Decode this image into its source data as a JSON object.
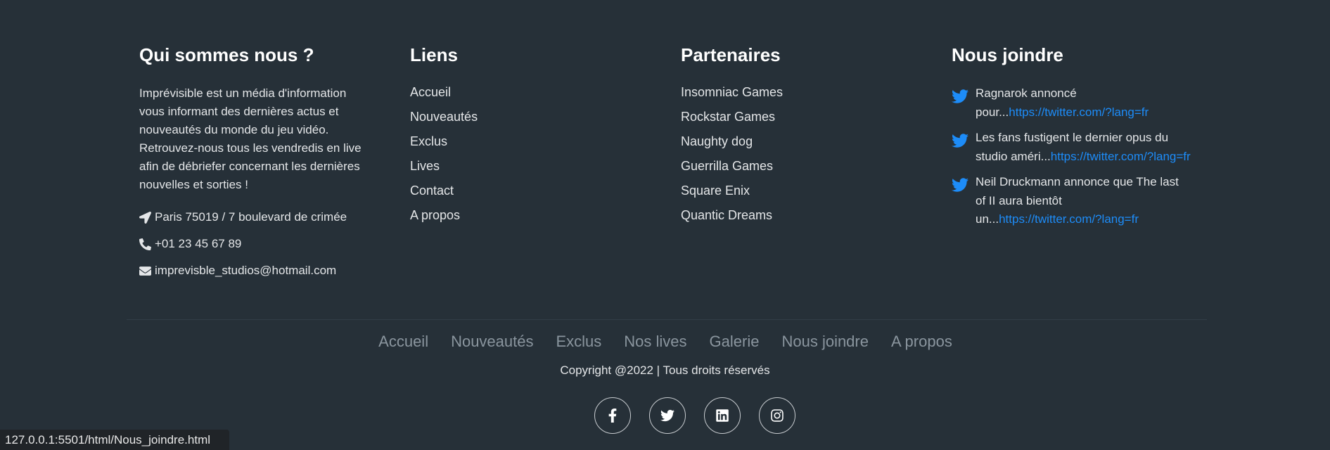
{
  "about": {
    "title": "Qui sommes nous ?",
    "text": "Imprévisible est un média d'information vous informant des dernières actus et nouveautés du monde du jeu vidéo. Retrouvez-nous tous les vendredis en live afin de débriefer concernant les dernières nouvelles et sorties !",
    "address": "Paris 75019 / 7 boulevard de crimée",
    "phone": "+01 23 45 67 89",
    "email": "imprevisble_studios@hotmail.com"
  },
  "links": {
    "title": "Liens",
    "items": [
      "Accueil",
      "Nouveautés",
      "Exclus",
      "Lives",
      "Contact",
      "A propos"
    ]
  },
  "partners": {
    "title": "Partenaires",
    "items": [
      "Insomniac Games",
      "Rockstar Games",
      "Naughty dog",
      "Guerrilla Games",
      "Square Enix",
      "Quantic Dreams"
    ]
  },
  "contact": {
    "title": "Nous joindre",
    "tweets": [
      {
        "text": "Ragnarok annoncé pour...",
        "link": "https://twitter.com/?lang=fr"
      },
      {
        "text": "Les fans fustigent le dernier opus du studio améri...",
        "link": "https://twitter.com/?lang=fr"
      },
      {
        "text": "Neil Druckmann annonce que The last of II aura bientôt un...",
        "link": "https://twitter.com/?lang=fr"
      }
    ]
  },
  "bottom_nav": [
    "Accueil",
    "Nouveautés",
    "Exclus",
    "Nos lives",
    "Galerie",
    "Nous joindre",
    "A propos"
  ],
  "copyright": "Copyright @2022 | Tous droits réservés",
  "socials": [
    "facebook-icon",
    "twitter-icon",
    "linkedin-icon",
    "instagram-icon"
  ],
  "status_url": "127.0.0.1:5501/html/Nous_joindre.html",
  "colors": {
    "background": "#263038",
    "link_blue": "#1d8cf8",
    "nav_gray": "#8a959e"
  }
}
